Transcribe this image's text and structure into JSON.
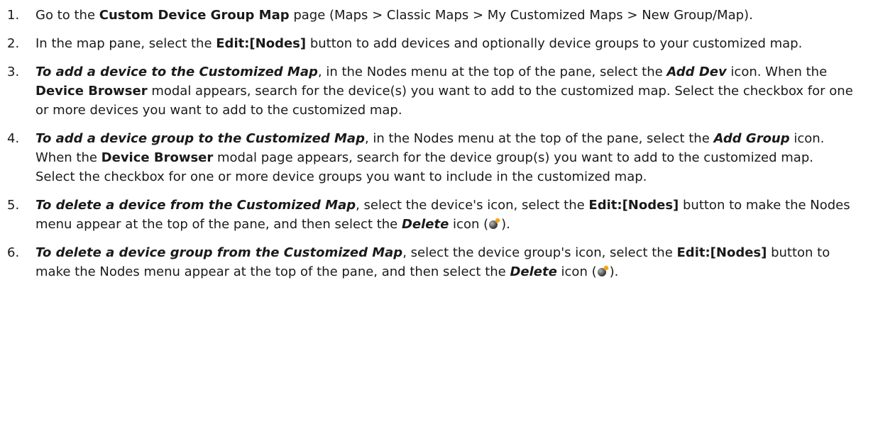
{
  "steps": [
    {
      "number": "1.",
      "segments": [
        {
          "text": "Go to the ",
          "style": "normal"
        },
        {
          "text": "Custom Device Group Map",
          "style": "bold"
        },
        {
          "text": " page (Maps > Classic Maps > My Customized Maps > New Group/Map).",
          "style": "normal"
        }
      ]
    },
    {
      "number": "2.",
      "segments": [
        {
          "text": "In the map pane, select the ",
          "style": "normal"
        },
        {
          "text": "Edit:[Nodes]",
          "style": "bold"
        },
        {
          "text": " button to add devices and optionally device groups to your customized map.",
          "style": "normal"
        }
      ]
    },
    {
      "number": "3.",
      "segments": [
        {
          "text": "To add a device to the Customized Map",
          "style": "bold-italic"
        },
        {
          "text": ", in the Nodes menu at the top of the pane, select the ",
          "style": "normal"
        },
        {
          "text": "Add Dev",
          "style": "bold-italic"
        },
        {
          "text": " icon. When the ",
          "style": "normal"
        },
        {
          "text": "Device Browser",
          "style": "bold"
        },
        {
          "text": " modal appears, search for the device(s) you want to add to the customized map. Select the checkbox for one or more devices you want to add to the customized map.",
          "style": "normal"
        }
      ]
    },
    {
      "number": "4.",
      "segments": [
        {
          "text": "To add a device group to the Customized Map",
          "style": "bold-italic"
        },
        {
          "text": ", in the Nodes menu at the top of the pane, select the ",
          "style": "normal"
        },
        {
          "text": "Add Group",
          "style": "bold-italic"
        },
        {
          "text": " icon. When the ",
          "style": "normal"
        },
        {
          "text": "Device Browser",
          "style": "bold"
        },
        {
          "text": " modal page appears, search for the device group(s) you want to add to the customized map. Select the checkbox for one or more device groups you want to include in the customized map.",
          "style": "normal"
        }
      ]
    },
    {
      "number": "5.",
      "segments": [
        {
          "text": "To delete a device from the Customized Map",
          "style": "bold-italic"
        },
        {
          "text": ", select the device's icon, select the ",
          "style": "normal"
        },
        {
          "text": "Edit:[Nodes]",
          "style": "bold"
        },
        {
          "text": " button to make the Nodes menu appear at the top of the pane, and then select the ",
          "style": "normal"
        },
        {
          "text": "Delete",
          "style": "bold-italic"
        },
        {
          "text": " icon (",
          "style": "normal"
        },
        {
          "icon": "bomb-icon"
        },
        {
          "text": ").",
          "style": "normal"
        }
      ]
    },
    {
      "number": "6.",
      "segments": [
        {
          "text": "To delete a device group from the Customized Map",
          "style": "bold-italic"
        },
        {
          "text": ", select the device group's icon, select the ",
          "style": "normal"
        },
        {
          "text": "Edit:[Nodes]",
          "style": "bold"
        },
        {
          "text": " button to make the Nodes menu appear at the top of the pane, and then select the ",
          "style": "normal"
        },
        {
          "text": "Delete",
          "style": "bold-italic"
        },
        {
          "text": " icon (",
          "style": "normal"
        },
        {
          "icon": "bomb-icon"
        },
        {
          "text": ").",
          "style": "normal"
        }
      ]
    }
  ]
}
